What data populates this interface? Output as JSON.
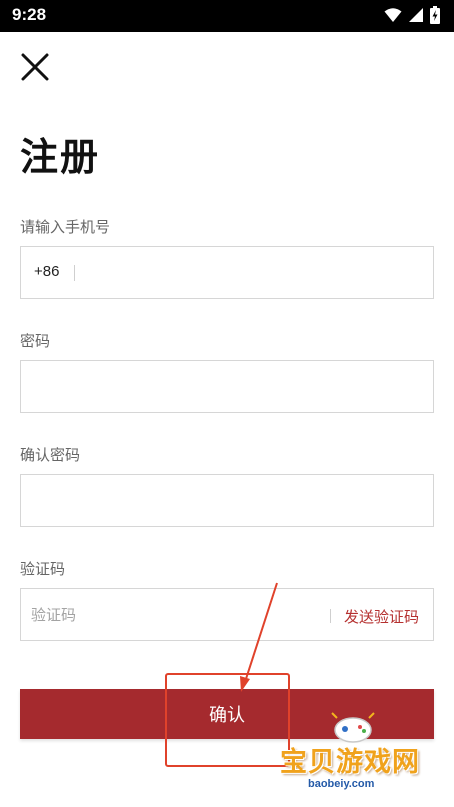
{
  "status_bar": {
    "time": "9:28"
  },
  "page": {
    "title": "注册"
  },
  "phone": {
    "label": "请输入手机号",
    "country_code": "+86",
    "value": ""
  },
  "password": {
    "label": "密码",
    "value": ""
  },
  "confirm_password": {
    "label": "确认密码",
    "value": ""
  },
  "verification": {
    "label": "验证码",
    "placeholder": "验证码",
    "send_label": "发送验证码",
    "value": ""
  },
  "confirm_button": {
    "label": "确认"
  },
  "watermark": {
    "text": "宝贝游戏网",
    "url": "baobeiy.com"
  },
  "colors": {
    "accent": "#a52a2e",
    "link": "#b5302f",
    "annotation": "#e0422b"
  }
}
